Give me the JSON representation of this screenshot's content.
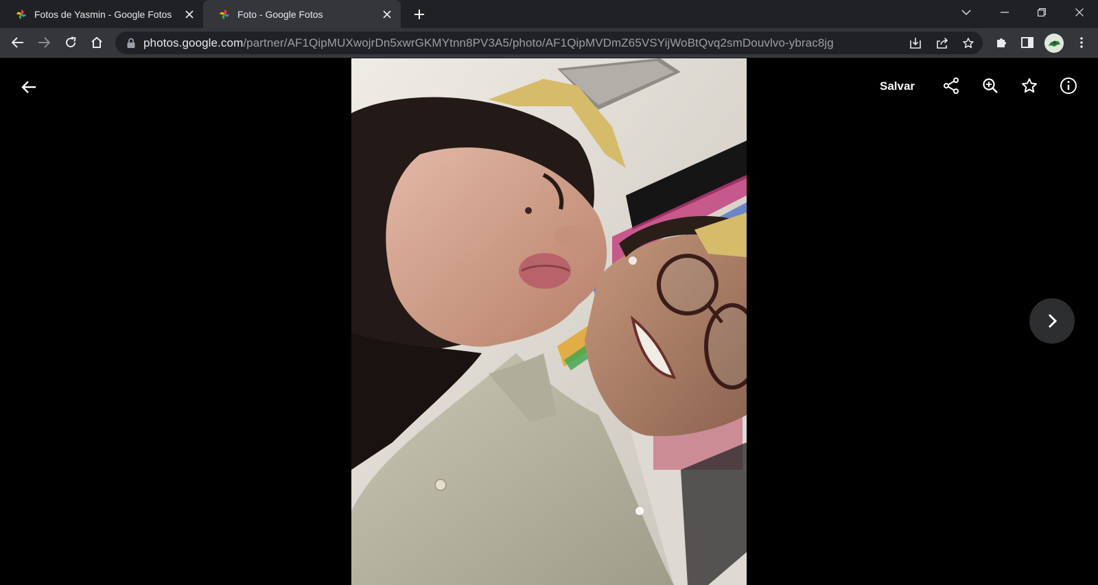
{
  "tabs": [
    {
      "title": "Fotos de Yasmin - Google Fotos",
      "active": false
    },
    {
      "title": "Foto - Google Fotos",
      "active": true
    }
  ],
  "omnibox": {
    "host": "photos.google.com",
    "path": "/partner/AF1QipMUXwojrDn5xwrGKMYtnn8PV3A5/photo/AF1QipMVDmZ65VSYijWoBtQvq2smDouvlvo-ybrac8jg"
  },
  "viewer": {
    "save_label": "Salvar"
  },
  "colors": {
    "tabstrip": "#202124",
    "toolbar": "#35363a",
    "viewer_bg": "#000000",
    "icon": "#ffffff"
  }
}
